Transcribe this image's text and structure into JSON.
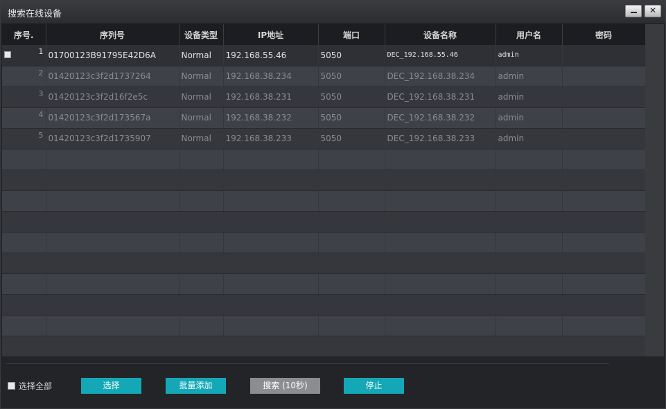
{
  "window": {
    "title": "搜索在线设备",
    "minimize_icon": "minimize-icon",
    "close_label": "✕"
  },
  "table": {
    "columns": [
      "序号.",
      "序列号",
      "设备类型",
      "IP地址",
      "端口",
      "设备名称",
      "用户名",
      "密码"
    ],
    "rows": [
      {
        "no": "1",
        "serial": "01700123B91795E42D6A",
        "type": "Normal",
        "ip": "192.168.55.46",
        "port": "5050",
        "name": "DEC_192.168.55.46",
        "user": "admin",
        "password": ""
      },
      {
        "no": "2",
        "serial": "01420123c3f2d1737264",
        "type": "Normal",
        "ip": "192.168.38.234",
        "port": "5050",
        "name": "DEC_192.168.38.234",
        "user": "admin",
        "password": ""
      },
      {
        "no": "3",
        "serial": "01420123c3f2d16f2e5c",
        "type": "Normal",
        "ip": "192.168.38.231",
        "port": "5050",
        "name": "DEC_192.168.38.231",
        "user": "admin",
        "password": ""
      },
      {
        "no": "4",
        "serial": "01420123c3f2d173567a",
        "type": "Normal",
        "ip": "192.168.38.232",
        "port": "5050",
        "name": "DEC_192.168.38.232",
        "user": "admin",
        "password": ""
      },
      {
        "no": "5",
        "serial": "01420123c3f2d1735907",
        "type": "Normal",
        "ip": "192.168.38.233",
        "port": "5050",
        "name": "DEC_192.168.38.233",
        "user": "admin",
        "password": ""
      }
    ]
  },
  "footer": {
    "select_all_label": "选择全部",
    "select_button": "选择",
    "batch_add_button": "批量添加",
    "search_button": "搜索 (10秒)",
    "stop_button": "停止"
  },
  "colors": {
    "accent": "#14a8b7",
    "disabled_button": "#8b8d91"
  }
}
